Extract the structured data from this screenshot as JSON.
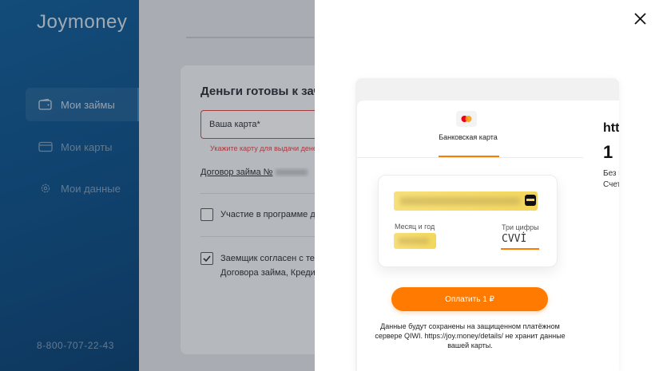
{
  "app": {
    "logo": "Joymoney"
  },
  "sidebar": {
    "items": [
      {
        "label": "Мои займы",
        "icon": "wallet-icon",
        "active": true
      },
      {
        "label": "Мои карты",
        "icon": "card-icon",
        "active": false
      },
      {
        "label": "Мои данные",
        "icon": "gear-icon",
        "active": false
      }
    ],
    "phone": "8-800-707-22-43"
  },
  "main": {
    "title": "Деньги готовы к зачислению",
    "card_field_label": "Ваша карта*",
    "card_field_error": "Укажите карту для выдачи денег",
    "contract_label": "Договор займа №",
    "loyalty_label": "Участие в программе до",
    "consent_line1": "Заемщик согласен с тем",
    "consent_line2": "Договора займа, Кредит"
  },
  "payment": {
    "tab_label": "Банковская карта",
    "card_number_placeholder": "Номер карты",
    "expiry_label": "Месяц и год",
    "cvv_label": "Три цифры",
    "cvv_value": "CVVİ",
    "pay_button": "Оплатить 1 ₽",
    "disclaimer": "Данные будут сохранены на защищенном платёжном сервере QIWI. https://joy.money/details/ не хранит данные вашей карты.",
    "accent_color": "#ff7a00"
  },
  "order_summary": {
    "merchant": "htt",
    "amount": "1",
    "line1": "Без к",
    "line2": "Счет"
  }
}
